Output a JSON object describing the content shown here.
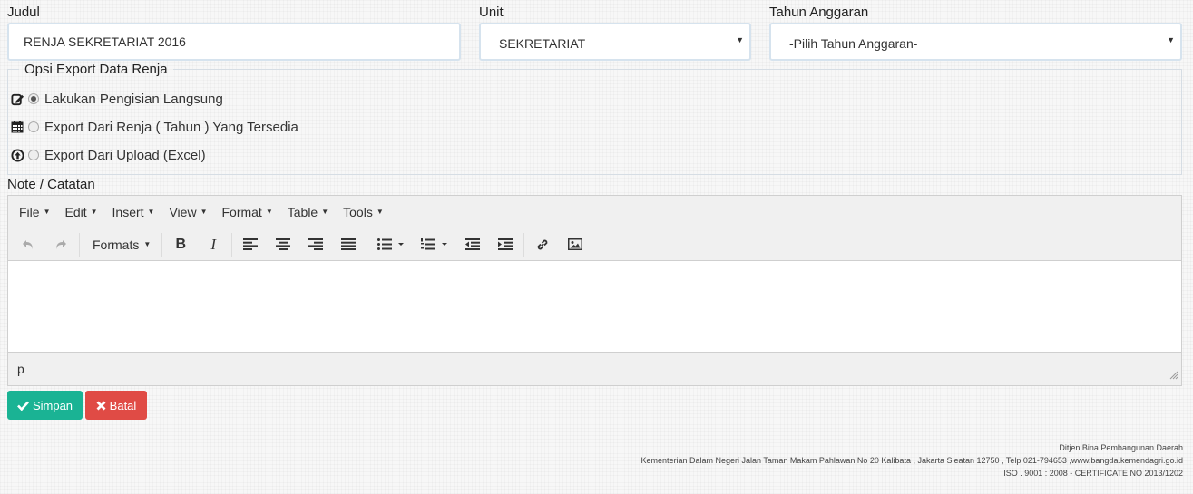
{
  "form": {
    "judul_label": "Judul",
    "judul_value": "RENJA SEKRETARIAT 2016",
    "unit_label": "Unit",
    "unit_value": "SEKRETARIAT",
    "tahun_label": "Tahun Anggaran",
    "tahun_value": "-Pilih Tahun Anggaran-"
  },
  "opsi": {
    "legend": "Opsi Export Data Renja",
    "options": [
      {
        "label": "Lakukan Pengisian Langsung",
        "icon": "edit-icon",
        "checked": true
      },
      {
        "label": "Export Dari Renja ( Tahun ) Yang Tersedia",
        "icon": "calendar-icon",
        "checked": false
      },
      {
        "label": "Export Dari Upload (Excel)",
        "icon": "upload-icon",
        "checked": false
      }
    ]
  },
  "note": {
    "label": "Note / Catatan",
    "menu": [
      "File",
      "Edit",
      "Insert",
      "View",
      "Format",
      "Table",
      "Tools"
    ],
    "formats_label": "Formats",
    "status_path": "p"
  },
  "buttons": {
    "simpan": "Simpan",
    "batal": "Batal"
  },
  "colors": {
    "simpan_bg": "#1ab394",
    "batal_bg": "#e04b45"
  },
  "footer": {
    "line1": "Ditjen Bina Pembangunan Daerah",
    "line2": "Kementerian Dalam Negeri Jalan Taman Makam Pahlawan No 20 Kalibata , Jakarta Sleatan 12750 , Telp 021-794653 ,www.bangda.kemendagri.go.id",
    "line3": "ISO . 9001 : 2008 - CERTIFICATE NO 2013/1202"
  }
}
